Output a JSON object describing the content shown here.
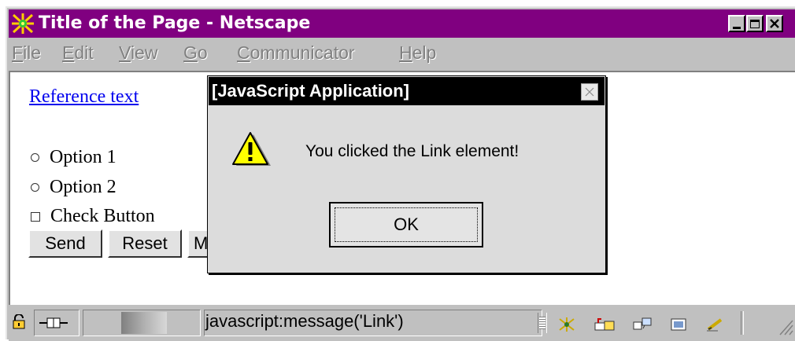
{
  "window": {
    "title": "Title of the Page - Netscape",
    "title_bar_color": "#800080",
    "controls": [
      "minimize-icon",
      "maximize-icon",
      "close-icon"
    ]
  },
  "menu": {
    "items": [
      {
        "mnemonic": "F",
        "rest": "ile"
      },
      {
        "mnemonic": "E",
        "rest": "dit"
      },
      {
        "mnemonic": "V",
        "rest": "iew"
      },
      {
        "mnemonic": "G",
        "rest": "o"
      },
      {
        "mnemonic": "C",
        "rest": "ommunicator"
      },
      {
        "mnemonic": "H",
        "rest": "elp"
      }
    ]
  },
  "page": {
    "link_text": "Reference text",
    "link_color": "#0000ee",
    "radio_options": [
      {
        "label": "Option 1",
        "checked": false
      },
      {
        "label": "Option 2",
        "checked": false
      }
    ],
    "checkbox": {
      "label": "Check Button",
      "checked": false
    },
    "buttons": {
      "send": "Send",
      "reset": "Reset",
      "partial": "M"
    }
  },
  "status": {
    "text": "javascript:message('Link')",
    "icons": [
      "security-lock-icon",
      "connection-icon",
      "progress-bar",
      "navigator-icon",
      "mailbox-icon",
      "discussions-icon",
      "composer-icon",
      "edit-icon"
    ]
  },
  "dialog": {
    "title": "[JavaScript Application]",
    "message": "You clicked the Link element!",
    "ok_label": "OK",
    "icon": "warning-icon"
  }
}
